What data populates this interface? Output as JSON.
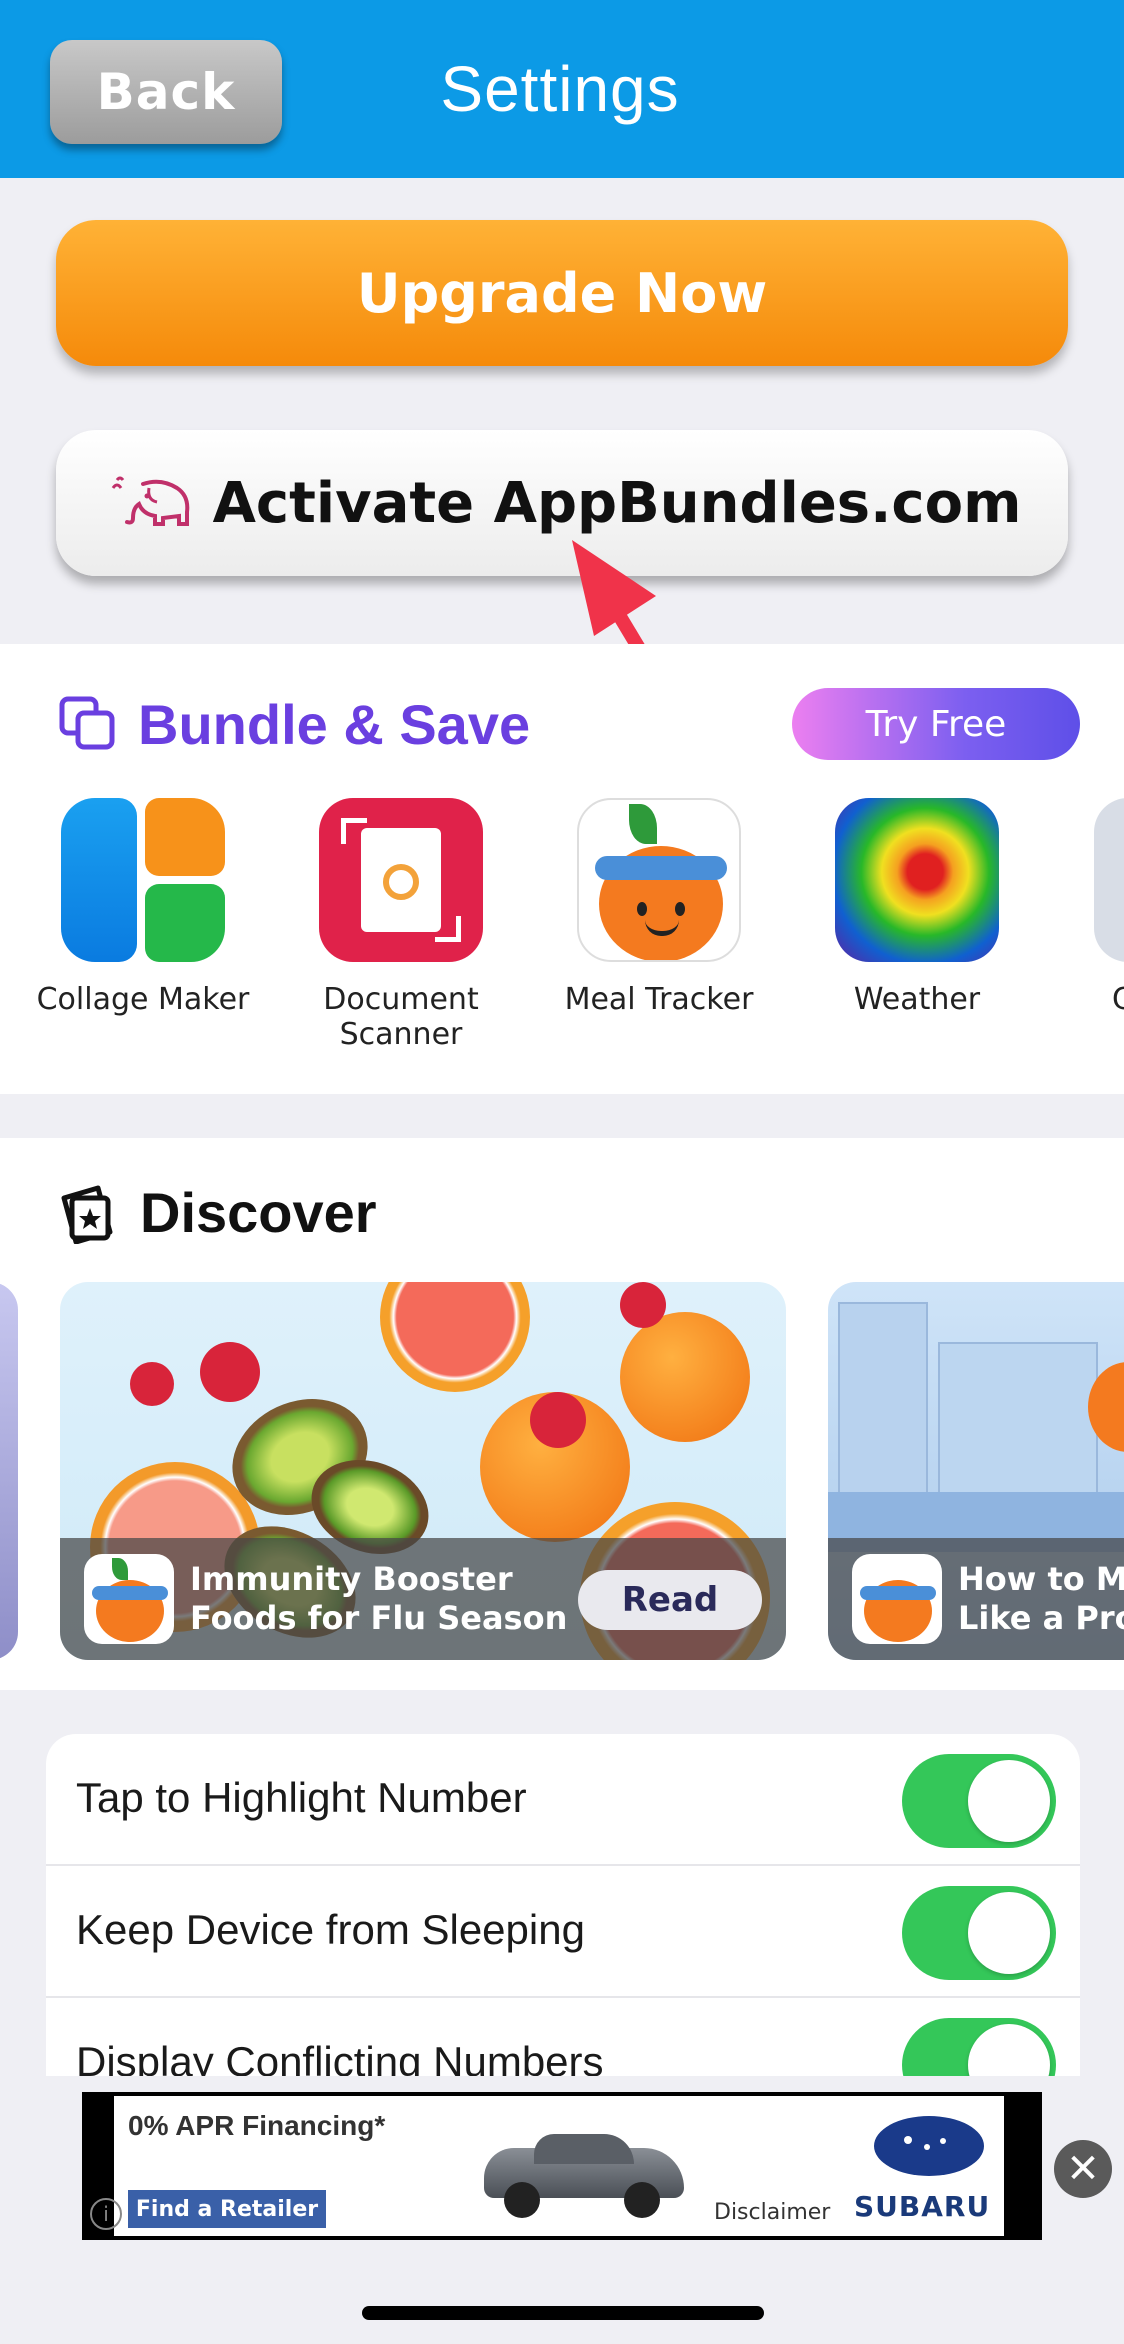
{
  "header": {
    "back_label": "Back",
    "title": "Settings"
  },
  "actions": {
    "upgrade_label": "Upgrade Now",
    "activate_label": "Activate AppBundles.com"
  },
  "bundle": {
    "title": "Bundle & Save",
    "try_free_label": "Try Free",
    "apps": [
      {
        "label": "Collage Maker"
      },
      {
        "label": "Document\nScanner"
      },
      {
        "label": "Meal Tracker"
      },
      {
        "label": "Weather"
      },
      {
        "label": "C"
      }
    ]
  },
  "discover": {
    "title": "Discover",
    "cards": [
      {
        "title_line1": "Immunity Booster",
        "title_line2": "Foods for Flu Season",
        "action": "Read"
      },
      {
        "title_line1": "How to Ma",
        "title_line2": "Like a Pro"
      }
    ]
  },
  "settings": [
    {
      "label": "Tap to Highlight Number",
      "on": true
    },
    {
      "label": "Keep Device from Sleeping",
      "on": true
    },
    {
      "label": "Display Conflicting Numbers",
      "on": true
    }
  ],
  "ad": {
    "headline": "0% APR Financing*",
    "cta": "Find a Retailer",
    "disclaimer": "Disclaimer",
    "brand": "SUBARU",
    "close_symbol": "✕"
  },
  "colors": {
    "header": "#0c9ae6",
    "upgrade": "#f58a0a",
    "bundle_title": "#6a3fe0",
    "toggle_on": "#34c759"
  }
}
